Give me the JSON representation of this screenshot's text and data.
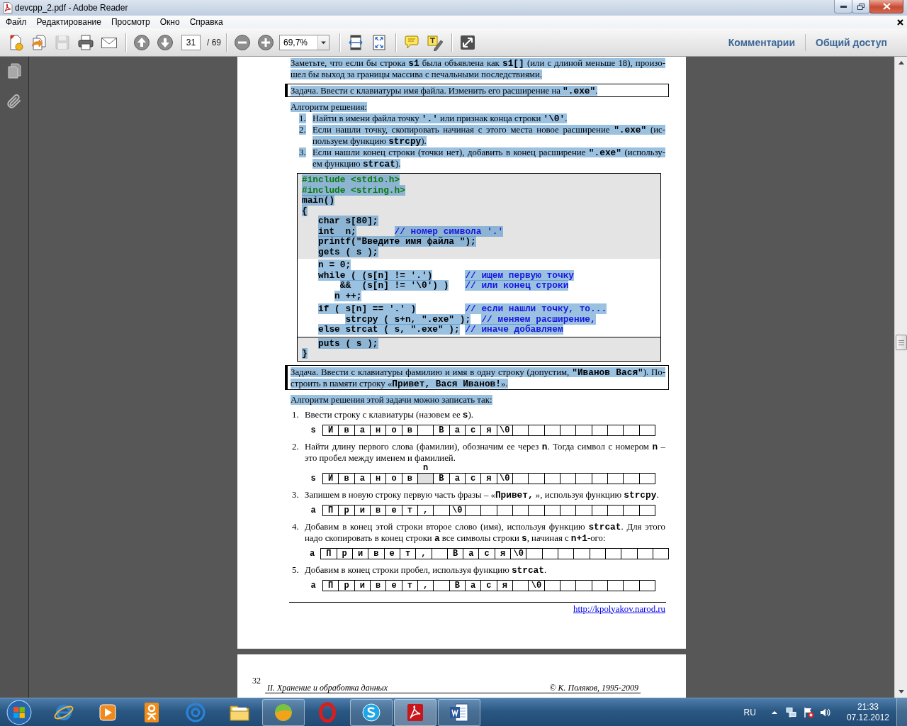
{
  "window": {
    "title": "devcpp_2.pdf - Adobe Reader"
  },
  "menu": [
    "Файл",
    "Редактирование",
    "Просмотр",
    "Окно",
    "Справка"
  ],
  "toolbar": {
    "groups": [
      [
        {
          "kind": "create",
          "disabled": false
        },
        {
          "kind": "export",
          "disabled": false
        },
        {
          "kind": "save",
          "disabled": true
        },
        {
          "kind": "print",
          "disabled": false
        },
        {
          "kind": "mail",
          "disabled": false
        }
      ],
      [
        {
          "kind": "prev",
          "disabled": false
        },
        {
          "kind": "next",
          "disabled": false
        }
      ],
      [
        {
          "kind": "zoomout",
          "disabled": false
        },
        {
          "kind": "zoomin",
          "disabled": false
        }
      ],
      [
        {
          "kind": "fitwidth",
          "disabled": false
        },
        {
          "kind": "fitpage",
          "disabled": false
        }
      ],
      [
        {
          "kind": "comment",
          "disabled": false
        },
        {
          "kind": "highlight",
          "disabled": false
        }
      ],
      [
        {
          "kind": "fullscreen",
          "disabled": false
        }
      ]
    ],
    "page_number": "31",
    "page_count": "/ 69",
    "zoom": "69,7%",
    "panes": [
      "Комментарии",
      "Общий доступ"
    ]
  },
  "page": {
    "blocks": [
      {
        "kind": "paragraph",
        "highlighted": true,
        "lines": [
          "Заметьте, что если бы строка **s1** была объявлена как **s1[]** (или с длиной меньше 18), произо-",
          "шел бы выход за границы массива с печальными последствиями."
        ]
      },
      {
        "kind": "task",
        "highlighted": true,
        "lines": [
          "Задача. Ввести с клавиатуры имя файла. Изменить его расширение на **\".exe\"**."
        ]
      },
      {
        "kind": "heading",
        "highlighted": true,
        "lines": [
          "Алгоритм решения:"
        ]
      },
      {
        "kind": "list",
        "highlighted": true,
        "items": [
          {
            "number": "1.",
            "lines": [
              "Найти в имени файла точку **'.'** или признак конца строки **'\\0'**."
            ]
          },
          {
            "number": "2.",
            "lines": [
              "Если нашли точку, скопировать начиная с этого места новое расширение **\".exe\"** (ис-",
              "пользуем функцию **strcpy**)."
            ]
          },
          {
            "number": "3.",
            "lines": [
              "Если нашли конец строки (точки нет), добавить в конец расширение **\".exe\"** (использу-",
              "ем функцию **strcat**)."
            ]
          }
        ]
      },
      {
        "kind": "code",
        "highlighted": true,
        "sections": [
          {
            "shaded": true,
            "lines": [
              {
                "kind": "directive",
                "code": "#include <stdio.h>"
              },
              {
                "kind": "directive",
                "code": "#include <string.h>"
              },
              {
                "kind": "statement",
                "code": "main()"
              },
              {
                "kind": "statement",
                "code": "{"
              },
              {
                "kind": "statement",
                "code": "   char s[80];"
              },
              {
                "kind": "statement",
                "code": "   int  n;       ",
                "comment": "// номер символа '.'"
              },
              {
                "kind": "statement",
                "code": "   printf(\"Введите имя файла \");"
              },
              {
                "kind": "statement",
                "code": "   gets ( s );"
              }
            ]
          },
          {
            "shaded": false,
            "lines": [
              {
                "kind": "statement",
                "code": "   n = 0;"
              },
              {
                "kind": "statement",
                "code": "   while ( (s[n] != '.')      ",
                "comment": "// ищем первую точку"
              },
              {
                "kind": "statement",
                "code": "       &&  (s[n] != '\\0') )   ",
                "comment": "// или конец строки"
              },
              {
                "kind": "statement",
                "code": "      n ++;"
              }
            ]
          },
          {
            "shaded": false,
            "lines": [
              {
                "kind": "statement",
                "code": "   if ( s[n] == '.' )         ",
                "comment": "// если нашли точку, то..."
              },
              {
                "kind": "statement",
                "code": "        strcpy ( s+n, \".exe\" );  ",
                "comment": "// меняем расширение,"
              },
              {
                "kind": "statement",
                "code": "   else strcat ( s, \".exe\" ); ",
                "comment": "// иначе добавляем"
              }
            ]
          },
          {
            "shaded": true,
            "lines": [
              {
                "kind": "statement",
                "code": "   puts ( s );"
              },
              {
                "kind": "statement",
                "code": "}"
              }
            ]
          }
        ]
      },
      {
        "kind": "task",
        "highlighted": true,
        "lines": [
          "Задача. Ввести с клавиатуры фамилию и имя в одну строку (допустим, **\"Иванов Вася\"**). По-",
          "строить в памяти строку «**Привет, Вася Иванов!**»."
        ]
      },
      {
        "kind": "heading",
        "highlighted": true,
        "lines": [
          "Алгоритм решения этой задачи  можно записать так:"
        ]
      },
      {
        "kind": "steps",
        "highlighted": false,
        "items": [
          {
            "number": "1.",
            "lines": [
              "Ввести строку с клавиатуры (назовем ее **s**)."
            ],
            "array": {
              "label": "s",
              "cells": [
                {
                  "char": "И",
                  "shaded": false
                },
                {
                  "char": "в",
                  "shaded": false
                },
                {
                  "char": "а",
                  "shaded": false
                },
                {
                  "char": "н",
                  "shaded": false
                },
                {
                  "char": "о",
                  "shaded": false
                },
                {
                  "char": "в",
                  "shaded": false
                },
                {
                  "shaded": false
                },
                {
                  "char": "В",
                  "shaded": false
                },
                {
                  "char": "а",
                  "shaded": false
                },
                {
                  "char": "с",
                  "shaded": false
                },
                {
                  "char": "я",
                  "shaded": false
                },
                {
                  "char": "\\0",
                  "shaded": false
                },
                {
                  "shaded": false
                },
                {
                  "shaded": false
                },
                {
                  "shaded": false
                },
                {
                  "shaded": false
                },
                {
                  "shaded": false
                },
                {
                  "shaded": false
                },
                {
                  "shaded": false
                },
                {
                  "shaded": false
                },
                {
                  "shaded": false
                }
              ]
            }
          },
          {
            "number": "2.",
            "lines": [
              "Найти длину первого слова (фамилии), обозначим ее через **n**. Тогда символ с номером **n** –",
              "это пробел между именем и фамилией."
            ],
            "array": {
              "label": "s",
              "cells": [
                {
                  "char": "И",
                  "shaded": false
                },
                {
                  "char": "в",
                  "shaded": false
                },
                {
                  "char": "а",
                  "shaded": false
                },
                {
                  "char": "н",
                  "shaded": false
                },
                {
                  "char": "о",
                  "shaded": false
                },
                {
                  "char": "в",
                  "shaded": false
                },
                {
                  "shaded": true,
                  "pointer": "n"
                },
                {
                  "char": "В",
                  "shaded": false
                },
                {
                  "char": "а",
                  "shaded": false
                },
                {
                  "char": "с",
                  "shaded": false
                },
                {
                  "char": "я",
                  "shaded": false
                },
                {
                  "char": "\\0",
                  "shaded": false
                },
                {
                  "shaded": false
                },
                {
                  "shaded": false
                },
                {
                  "shaded": false
                },
                {
                  "shaded": false
                },
                {
                  "shaded": false
                },
                {
                  "shaded": false
                },
                {
                  "shaded": false
                },
                {
                  "shaded": false
                },
                {
                  "shaded": false
                }
              ]
            }
          },
          {
            "number": "3.",
            "lines": [
              "Запишем в новую строку первую часть фразы – «**Привет,** », используя функцию **strcpy**."
            ],
            "array": {
              "label": "a",
              "cells": [
                {
                  "char": "П",
                  "shaded": false
                },
                {
                  "char": "р",
                  "shaded": false
                },
                {
                  "char": "и",
                  "shaded": false
                },
                {
                  "char": "в",
                  "shaded": false
                },
                {
                  "char": "е",
                  "shaded": false
                },
                {
                  "char": "т",
                  "shaded": false
                },
                {
                  "char": ",",
                  "shaded": false
                },
                {
                  "shaded": false
                },
                {
                  "char": "\\0",
                  "shaded": false
                },
                {
                  "shaded": false
                },
                {
                  "shaded": false
                },
                {
                  "shaded": false
                },
                {
                  "shaded": false
                },
                {
                  "shaded": false
                },
                {
                  "shaded": false
                },
                {
                  "shaded": false
                },
                {
                  "shaded": false
                },
                {
                  "shaded": false
                },
                {
                  "shaded": false
                },
                {
                  "shaded": false
                },
                {
                  "shaded": false
                }
              ]
            }
          },
          {
            "number": "4.",
            "lines": [
              "Добавим в конец этой строки второе слово (имя), используя функцию **strcat**. Для этого",
              "надо скопировать в конец строки **a** все символы строки **s**, начиная с **n+1**-ого:"
            ],
            "array": {
              "label": "a",
              "cells": [
                {
                  "char": "П",
                  "shaded": false
                },
                {
                  "char": "р",
                  "shaded": false
                },
                {
                  "char": "и",
                  "shaded": false
                },
                {
                  "char": "в",
                  "shaded": false
                },
                {
                  "char": "е",
                  "shaded": false
                },
                {
                  "char": "т",
                  "shaded": false
                },
                {
                  "char": ",",
                  "shaded": false
                },
                {
                  "shaded": false
                },
                {
                  "char": "В",
                  "shaded": false
                },
                {
                  "char": "а",
                  "shaded": false
                },
                {
                  "char": "с",
                  "shaded": false
                },
                {
                  "char": "я",
                  "shaded": false
                },
                {
                  "char": "\\0",
                  "shaded": false
                },
                {
                  "shaded": false
                },
                {
                  "shaded": false
                },
                {
                  "shaded": false
                },
                {
                  "shaded": false
                },
                {
                  "shaded": false
                },
                {
                  "shaded": false
                },
                {
                  "shaded": false
                },
                {
                  "shaded": false
                },
                {
                  "shaded": false
                }
              ]
            }
          },
          {
            "number": "5.",
            "lines": [
              "Добавим в конец строки пробел, используя функцию **strcat**."
            ],
            "array": {
              "label": "a",
              "cells": [
                {
                  "char": "П",
                  "shaded": false
                },
                {
                  "char": "р",
                  "shaded": false
                },
                {
                  "char": "и",
                  "shaded": false
                },
                {
                  "char": "в",
                  "shaded": false
                },
                {
                  "char": "е",
                  "shaded": false
                },
                {
                  "char": "т",
                  "shaded": false
                },
                {
                  "char": ",",
                  "shaded": false
                },
                {
                  "shaded": false
                },
                {
                  "char": "В",
                  "shaded": false
                },
                {
                  "char": "а",
                  "shaded": false
                },
                {
                  "char": "с",
                  "shaded": false
                },
                {
                  "char": "я",
                  "shaded": false
                },
                {
                  "shaded": false
                },
                {
                  "char": "\\0",
                  "shaded": false
                },
                {
                  "shaded": false
                },
                {
                  "shaded": false
                },
                {
                  "shaded": false
                },
                {
                  "shaded": false
                },
                {
                  "shaded": false
                },
                {
                  "shaded": false
                },
                {
                  "shaded": false
                }
              ]
            }
          }
        ]
      },
      {
        "kind": "link",
        "url": "http://kpolyakov.narod.ru"
      }
    ]
  },
  "next_page": {
    "number": "32",
    "chapter": "II. Хранение и обработка данных",
    "copyright": "© К. Поляков, 1995-2009"
  },
  "taskbar": {
    "apps": [
      {
        "kind": "browser",
        "running": false,
        "selected": false
      },
      {
        "kind": "player",
        "running": false,
        "selected": false
      },
      {
        "kind": "social",
        "running": false,
        "selected": false
      },
      {
        "kind": "mail",
        "running": false,
        "selected": false
      },
      {
        "kind": "explorer",
        "running": false,
        "selected": false
      },
      {
        "kind": "ball",
        "running": true,
        "selected": false
      },
      {
        "kind": "opera",
        "running": false,
        "selected": false
      },
      {
        "kind": "messenger",
        "running": true,
        "selected": false
      },
      {
        "kind": "reader",
        "running": true,
        "selected": true
      },
      {
        "kind": "writer",
        "running": true,
        "selected": false
      }
    ],
    "language": "RU",
    "time": "21:33",
    "date": "07.12.2012"
  }
}
